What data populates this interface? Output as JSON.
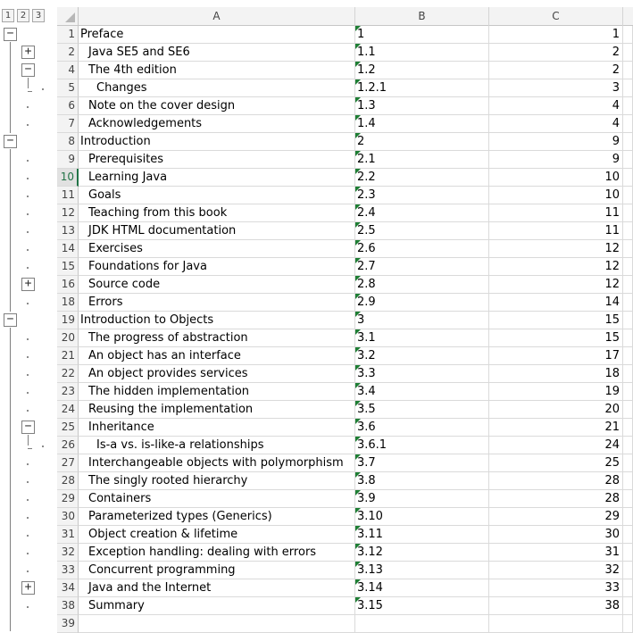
{
  "outline": {
    "levels": [
      "1",
      "2",
      "3"
    ]
  },
  "columns": [
    "A",
    "B",
    "C"
  ],
  "rows": [
    {
      "num": "1",
      "a": "Preface",
      "b": "1",
      "c": "1"
    },
    {
      "num": "2",
      "a": "Java SE5 and SE6",
      "b": "1.1",
      "c": "2"
    },
    {
      "num": "4",
      "a": "The 4th edition",
      "b": "1.2",
      "c": "2"
    },
    {
      "num": "5",
      "a": "Changes",
      "b": "1.2.1",
      "c": "3"
    },
    {
      "num": "6",
      "a": "Note on the cover design",
      "b": "1.3",
      "c": "4"
    },
    {
      "num": "7",
      "a": "Acknowledgements",
      "b": "1.4",
      "c": "4"
    },
    {
      "num": "8",
      "a": "Introduction",
      "b": "2",
      "c": "9"
    },
    {
      "num": "9",
      "a": "Prerequisites",
      "b": "2.1",
      "c": "9"
    },
    {
      "num": "10",
      "a": "Learning Java",
      "b": "2.2",
      "c": "10"
    },
    {
      "num": "11",
      "a": "Goals",
      "b": "2.3",
      "c": "10"
    },
    {
      "num": "12",
      "a": "Teaching from this book",
      "b": "2.4",
      "c": "11"
    },
    {
      "num": "13",
      "a": "JDK HTML documentation",
      "b": "2.5",
      "c": "11"
    },
    {
      "num": "14",
      "a": "Exercises",
      "b": "2.6",
      "c": "12"
    },
    {
      "num": "15",
      "a": "Foundations for Java",
      "b": "2.7",
      "c": "12"
    },
    {
      "num": "16",
      "a": "Source code",
      "b": "2.8",
      "c": "12"
    },
    {
      "num": "18",
      "a": "Errors",
      "b": "2.9",
      "c": "14"
    },
    {
      "num": "19",
      "a": "Introduction to Objects",
      "b": "3",
      "c": "15"
    },
    {
      "num": "20",
      "a": "The progress of abstraction",
      "b": "3.1",
      "c": "15"
    },
    {
      "num": "21",
      "a": "An object has an interface",
      "b": "3.2",
      "c": "17"
    },
    {
      "num": "22",
      "a": "An object provides services",
      "b": "3.3",
      "c": "18"
    },
    {
      "num": "23",
      "a": "The hidden implementation",
      "b": "3.4",
      "c": "19"
    },
    {
      "num": "24",
      "a": "Reusing the implementation",
      "b": "3.5",
      "c": "20"
    },
    {
      "num": "25",
      "a": "Inheritance",
      "b": "3.6",
      "c": "21"
    },
    {
      "num": "26",
      "a": "Is-a vs. is-like-a relationships",
      "b": "3.6.1",
      "c": "24"
    },
    {
      "num": "27",
      "a": "Interchangeable objects with polymorphism",
      "b": "3.7",
      "c": "25"
    },
    {
      "num": "28",
      "a": "The singly rooted hierarchy",
      "b": "3.8",
      "c": "28"
    },
    {
      "num": "29",
      "a": "Containers",
      "b": "3.9",
      "c": "28"
    },
    {
      "num": "30",
      "a": "Parameterized types (Generics)",
      "b": "3.10",
      "c": "29"
    },
    {
      "num": "31",
      "a": "Object creation & lifetime",
      "b": "3.11",
      "c": "30"
    },
    {
      "num": "32",
      "a": "Exception handling: dealing with errors",
      "b": "3.12",
      "c": "31"
    },
    {
      "num": "33",
      "a": "Concurrent programming",
      "b": "3.13",
      "c": "32"
    },
    {
      "num": "34",
      "a": "Java and the Internet",
      "b": "3.14",
      "c": "33"
    },
    {
      "num": "38",
      "a": "Summary",
      "b": "3.15",
      "c": "38"
    },
    {
      "num": "39",
      "a": "",
      "b": "",
      "c": ""
    }
  ],
  "colors": {
    "header_bg": "#f3f3f3",
    "gridline": "#dadada",
    "active_row": "#217346",
    "text_indicator": "#1e7e34"
  }
}
